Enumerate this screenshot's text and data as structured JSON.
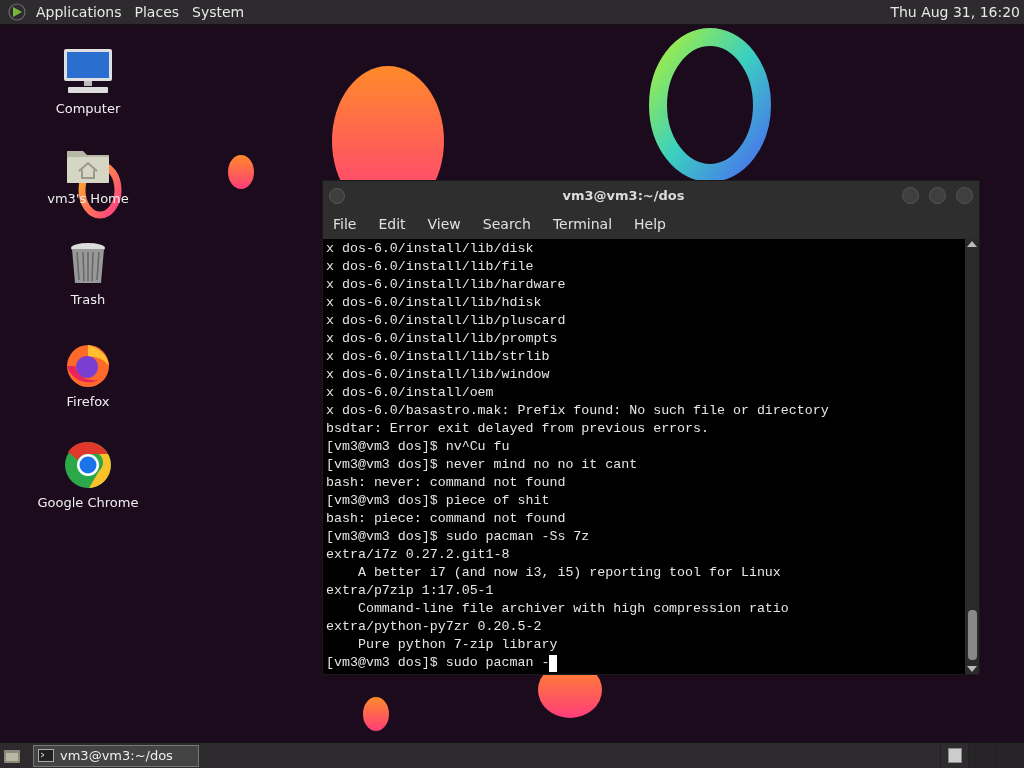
{
  "top_bar": {
    "menus": [
      "Applications",
      "Places",
      "System"
    ],
    "clock": "Thu Aug 31, 16:20"
  },
  "desktop_icons": [
    {
      "label": "Computer",
      "kind": "computer"
    },
    {
      "label": "vm3's Home",
      "kind": "home"
    },
    {
      "label": "Trash",
      "kind": "trash"
    },
    {
      "label": "Firefox",
      "kind": "firefox"
    },
    {
      "label": "Google Chrome",
      "kind": "chrome"
    }
  ],
  "terminal": {
    "title": "vm3@vm3:~/dos",
    "menu": [
      "File",
      "Edit",
      "View",
      "Search",
      "Terminal",
      "Help"
    ],
    "lines": [
      "x dos-6.0/install/lib/disk",
      "x dos-6.0/install/lib/file",
      "x dos-6.0/install/lib/hardware",
      "x dos-6.0/install/lib/hdisk",
      "x dos-6.0/install/lib/pluscard",
      "x dos-6.0/install/lib/prompts",
      "x dos-6.0/install/lib/strlib",
      "x dos-6.0/install/lib/window",
      "x dos-6.0/install/oem",
      "x dos-6.0/basastro.mak: Prefix found: No such file or directory",
      "bsdtar: Error exit delayed from previous errors.",
      "[vm3@vm3 dos]$ nv^Cu fu",
      "[vm3@vm3 dos]$ never mind no no it cant",
      "bash: never: command not found",
      "[vm3@vm3 dos]$ piece of shit",
      "bash: piece: command not found",
      "[vm3@vm3 dos]$ sudo pacman -Ss 7z",
      "extra/i7z 0.27.2.git1-8",
      "    A better i7 (and now i3, i5) reporting tool for Linux",
      "extra/p7zip 1:17.05-1",
      "    Command-line file archiver with high compression ratio",
      "extra/python-py7zr 0.20.5-2",
      "    Pure python 7-zip library"
    ],
    "input_line": {
      "text": "[vm3@vm3 dos]$ sudo pacman -",
      "cursor": true
    }
  },
  "taskbar": {
    "tasks": [
      {
        "label": "vm3@vm3:~/dos",
        "selected": true
      }
    ],
    "workspaces": [
      {
        "selected": true
      },
      {
        "selected": false
      },
      {
        "selected": false
      }
    ]
  }
}
